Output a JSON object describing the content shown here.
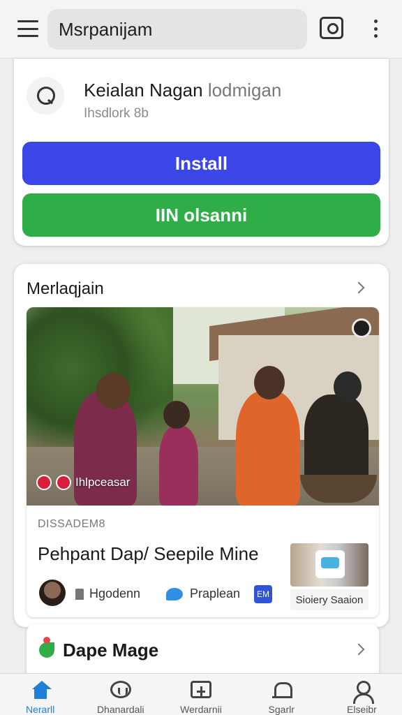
{
  "appbar": {
    "search_text": "Msrpanijam",
    "menu_icon": "hamburger-menu-icon",
    "camera_icon": "camera-icon",
    "more_icon": "more-vert-icon"
  },
  "app_card": {
    "title": "Keialan Nagan",
    "title_suffix": "lodmigan",
    "subtitle": "Ihsdlork 8b",
    "install_label": "Install",
    "secondary_label": "IIN olsanni",
    "colors": {
      "install": "#3b46e8",
      "secondary": "#2fae47"
    }
  },
  "section": {
    "title": "Merlaqjain"
  },
  "feature": {
    "caption": "Ihlpceasar",
    "category": "DISSADEM8",
    "headline": "Pehpant Dap/ Seepile Mine",
    "author": "Hgodenn",
    "platform": "Praplean",
    "badge": "EM",
    "thumb_label": "Sioiery Saaion"
  },
  "promo": {
    "title": "Dape Mage"
  },
  "bottom_nav": [
    {
      "label": "Nerarll",
      "icon": "home-icon",
      "active": true
    },
    {
      "label": "Dhanardali",
      "icon": "explore-icon",
      "active": false
    },
    {
      "label": "Werdarnii",
      "icon": "apps-icon",
      "active": false
    },
    {
      "label": "Sgarlr",
      "icon": "notifications-icon",
      "active": false
    },
    {
      "label": "Elseibr",
      "icon": "profile-icon",
      "active": false
    }
  ]
}
